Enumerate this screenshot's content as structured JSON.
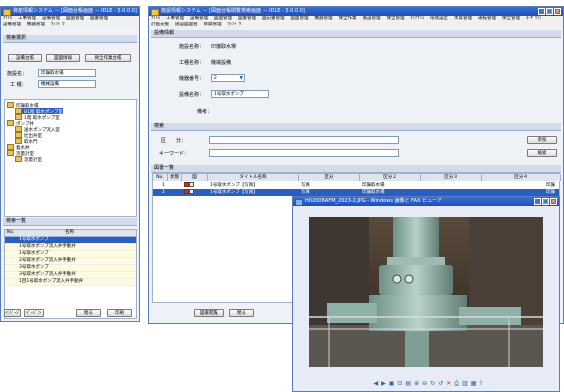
{
  "left_window": {
    "title": "資産情報システム － [図面台帳画面 － IDLE - 5.0.0.0]",
    "menu": [
      "ﾌｧｲﾙ",
      "工事管理",
      "設備管理",
      "図面管理",
      "図書管理",
      "設備管理",
      "機器管理",
      "ｳｨﾝﾄﾞｳ"
    ],
    "section_title": "検索選択",
    "buttons": [
      "設備台帳",
      "図面情報",
      "保全作業台帳"
    ],
    "facility_label": "施設名：",
    "facility_value": "印旛取水場",
    "works_label": "工 種：",
    "works_value": "機械設備",
    "tree_nodes": [
      "印旛取水場",
      "B1階 取水ポンプ室",
      "1階 取水ポンプ室",
      "ポンプ井",
      "送水ポンプ流入室",
      "吐出弁室",
      "取水門",
      "着水井",
      "流量計室",
      "流量計室"
    ],
    "list_title": "検索一覧",
    "list_headers": [
      "No.",
      "名称"
    ],
    "list_rows": [
      "1号取水ポンプ",
      "1号取水ポンプ流入弁手動弁",
      "1号取水ポンプ",
      "2号取水ポンプ流入弁手動弁",
      "3号取水ポンプ",
      "3号取水ポンプ流入弁手動弁",
      "1回1号取水ポンプ流入弁手動弁"
    ],
    "footer_buttons": [
      "＜ﾍﾟｰｼﾞ",
      "ﾍﾟｰｼﾞ＞",
      "閉る",
      "印刷"
    ]
  },
  "right_window": {
    "title": "施設情報システム － [図面台帳閲覧検索画面 － IDLE - 5.0.0.0]",
    "menu": [
      "ﾌｧｲﾙ",
      "工事管理",
      "設備管理",
      "図面管理",
      "図書管理",
      "図記書管理",
      "図面管理",
      "機器管理",
      "保全作業",
      "施設管理",
      "保全管理",
      "ﾒﾝﾃﾅﾝｽ",
      "環境設定",
      "水質管理",
      "運転管理",
      "保全管理",
      "ﾕｰｻﾞﾘﾃｨ"
    ],
    "menu2": [
      "計画支援",
      "施設図面管",
      "目録管理",
      "ｳｨﾝﾄﾞｳ"
    ],
    "info_title": "設備情報",
    "facility_label": "施設名称：",
    "facility_value": "印旛取水場",
    "works_label": "工種名称：",
    "works_value": "機械設備",
    "machine_label": "機器番号：",
    "machine_value": "2",
    "equip_label": "設備名称：",
    "equip_value": "1号取水ポンプ",
    "remarks_label": "備考：",
    "search_title": "検索",
    "category_label": "区　　分：",
    "keyword_label": "キーワード：",
    "ref_button": "参照",
    "search_button": "検索",
    "drawing_title": "図書一覧",
    "grid_headers": [
      "No.",
      "状態",
      "図",
      "タイトル名称",
      "区分",
      "区分２",
      "区分３",
      "区分４"
    ],
    "grid_rows": [
      {
        "no": "1",
        "title": "1号取水ポンプ【写真】",
        "k1": "写真",
        "k2": "印旛取水場",
        "k4": "印旛"
      },
      {
        "no": "2",
        "title": "1号取水ポンプ【写真】",
        "k1": "写真",
        "k2": "印旛取水場",
        "k4": "印旛"
      }
    ],
    "footer_buttons": [
      "図書閲覧",
      "閉る"
    ]
  },
  "viewer": {
    "title": "H0200BAFM_2023-2.JPG - Windows 画像と FAX ビューア",
    "toolbar_icons": [
      "prev-icon",
      "next-icon",
      "best-fit-icon",
      "actual-size-icon",
      "slideshow-icon",
      "zoom-in-icon",
      "zoom-out-icon",
      "rotate-cw-icon",
      "rotate-ccw-icon",
      "delete-icon",
      "print-icon",
      "save-icon",
      "open-icon",
      "help-icon"
    ]
  }
}
